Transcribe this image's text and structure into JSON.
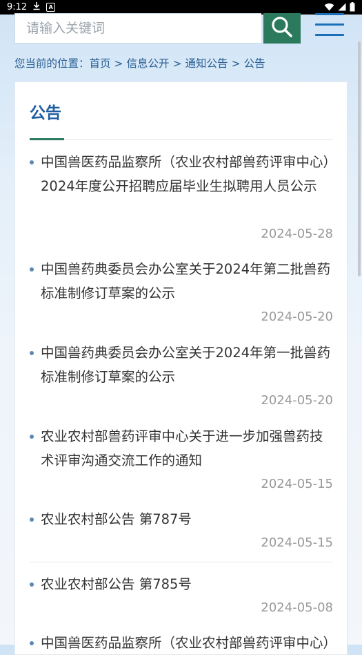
{
  "status_bar": {
    "time": "9:12",
    "icons_left": [
      "download-icon",
      "a-badge-icon"
    ],
    "icons_right": [
      "wifi-icon",
      "signal-icon",
      "battery-icon"
    ]
  },
  "search": {
    "placeholder": "请输入关键词",
    "button_icon": "search-icon"
  },
  "menu_icon": "hamburger-menu-icon",
  "breadcrumb": {
    "prefix": "您当前的位置：",
    "items": [
      "首页",
      "信息公开",
      "通知公告",
      "公告"
    ],
    "separator": ">"
  },
  "section": {
    "title": "公告"
  },
  "news": [
    {
      "title": "中国兽医药品监察所（农业农村部兽药评审中心）2024年度公开招聘应届毕业生拟聘用人员公示",
      "date": "2024-05-28"
    },
    {
      "title": "中国兽药典委员会办公室关于2024年第二批兽药标准制修订草案的公示",
      "date": "2024-05-20"
    },
    {
      "title": "中国兽药典委员会办公室关于2024年第一批兽药标准制修订草案的公示",
      "date": "2024-05-20"
    },
    {
      "title": "农业农村部兽药评审中心关于进一步加强兽药技术评审沟通交流工作的通知",
      "date": "2024-05-15"
    },
    {
      "title": "农业农村部公告 第787号",
      "date": "2024-05-15"
    },
    {
      "title": "农业农村部公告 第785号",
      "date": "2024-05-08"
    },
    {
      "title": "中国兽医药品监察所（农业农村部兽药评审中心）",
      "date": ""
    }
  ],
  "colors": {
    "accent_green": "#2b7a5e",
    "link_blue": "#2a5f93",
    "title_blue": "#1f5ea0",
    "date_gray": "#999999"
  }
}
